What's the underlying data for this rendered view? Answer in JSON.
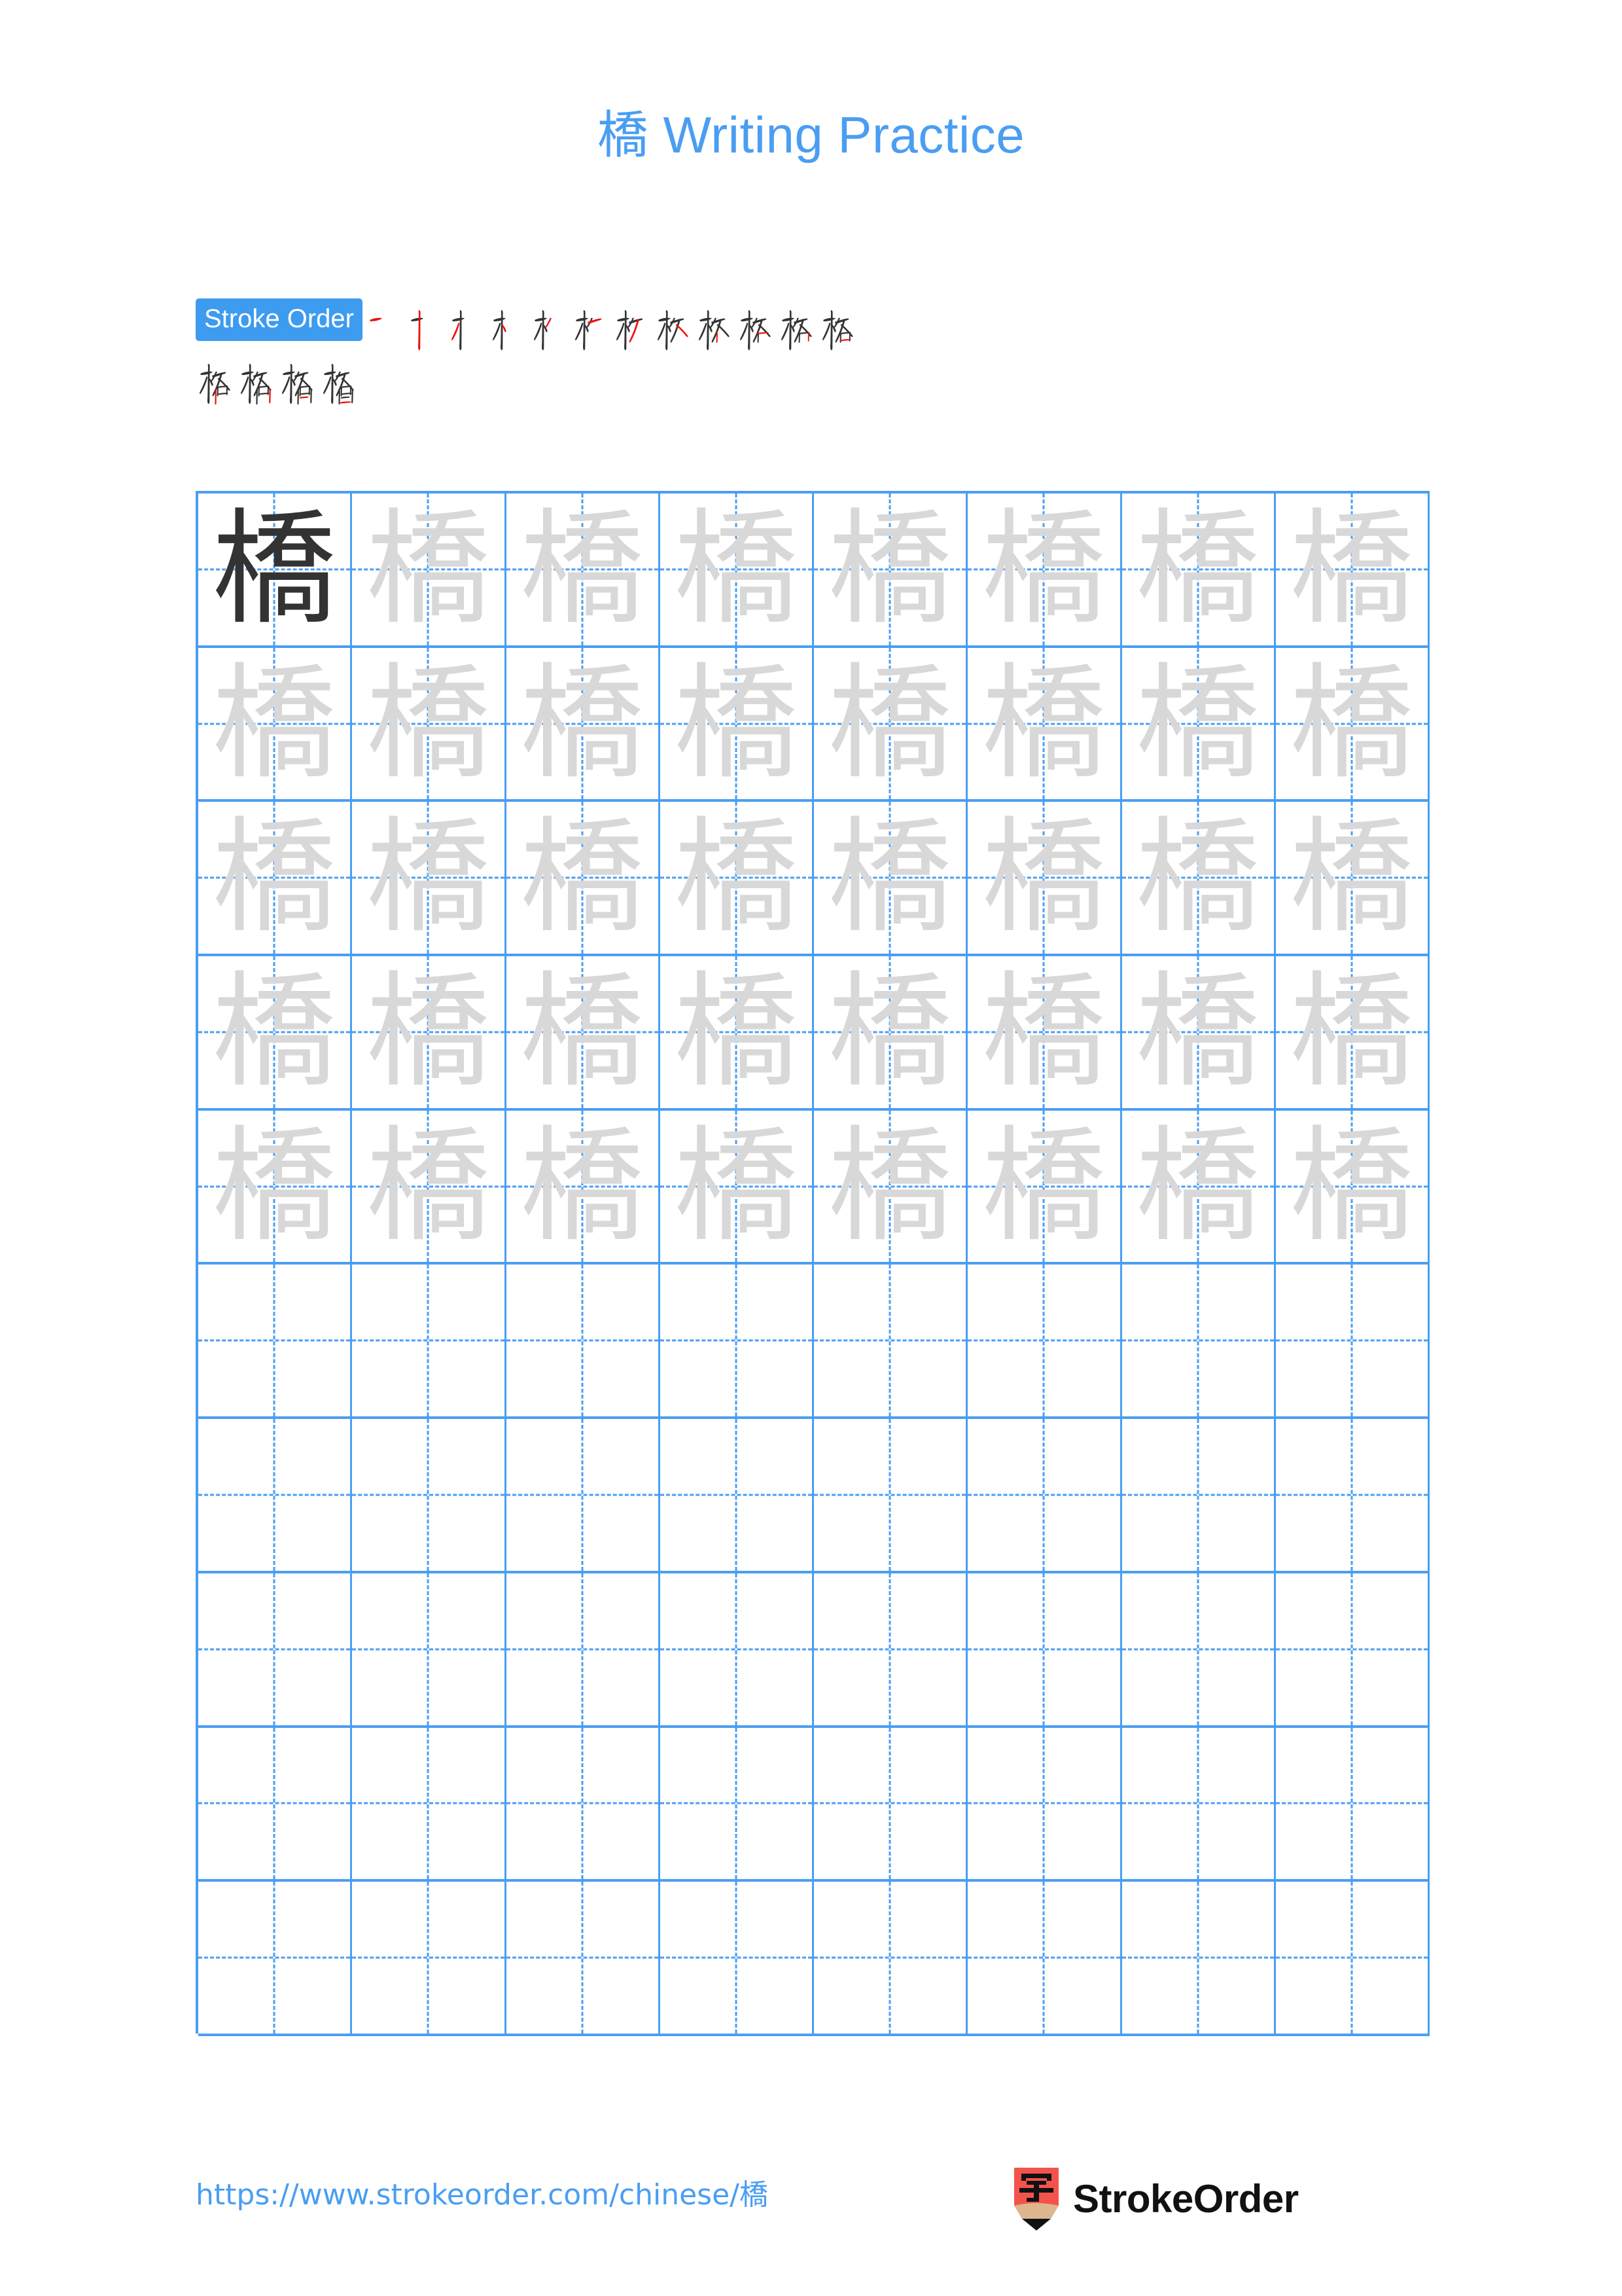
{
  "page": {
    "character": "橋",
    "title_suffix": " Writing Practice",
    "title_color": "#4a9ef2",
    "background_color": "#ffffff"
  },
  "stroke_order": {
    "badge_label": "Stroke Order",
    "badge_bg": "#3d9bf0",
    "badge_text_color": "#ffffff",
    "total_strokes": 16,
    "completed_stroke_color": "#333333",
    "current_stroke_color": "#ee1111",
    "row1_count": 12,
    "row2_count": 4,
    "steps": [
      {
        "index": 1,
        "strokes_shown": 1
      },
      {
        "index": 2,
        "strokes_shown": 2
      },
      {
        "index": 3,
        "strokes_shown": 3
      },
      {
        "index": 4,
        "strokes_shown": 4
      },
      {
        "index": 5,
        "strokes_shown": 5
      },
      {
        "index": 6,
        "strokes_shown": 6
      },
      {
        "index": 7,
        "strokes_shown": 7
      },
      {
        "index": 8,
        "strokes_shown": 8
      },
      {
        "index": 9,
        "strokes_shown": 9
      },
      {
        "index": 10,
        "strokes_shown": 10
      },
      {
        "index": 11,
        "strokes_shown": 11
      },
      {
        "index": 12,
        "strokes_shown": 12
      },
      {
        "index": 13,
        "strokes_shown": 13
      },
      {
        "index": 14,
        "strokes_shown": 14
      },
      {
        "index": 15,
        "strokes_shown": 15
      },
      {
        "index": 16,
        "strokes_shown": 16
      }
    ]
  },
  "grid": {
    "columns": 8,
    "rows": 10,
    "line_color": "#4a9ef2",
    "guide_style": "dashed",
    "dark_char_color": "#333333",
    "trace_char_color": "#d8d8d8",
    "rows_data": [
      {
        "row": 1,
        "cells": [
          "dark",
          "trace",
          "trace",
          "trace",
          "trace",
          "trace",
          "trace",
          "trace"
        ]
      },
      {
        "row": 2,
        "cells": [
          "trace",
          "trace",
          "trace",
          "trace",
          "trace",
          "trace",
          "trace",
          "trace"
        ]
      },
      {
        "row": 3,
        "cells": [
          "trace",
          "trace",
          "trace",
          "trace",
          "trace",
          "trace",
          "trace",
          "trace"
        ]
      },
      {
        "row": 4,
        "cells": [
          "trace",
          "trace",
          "trace",
          "trace",
          "trace",
          "trace",
          "trace",
          "trace"
        ]
      },
      {
        "row": 5,
        "cells": [
          "trace",
          "trace",
          "trace",
          "trace",
          "trace",
          "trace",
          "trace",
          "trace"
        ]
      },
      {
        "row": 6,
        "cells": [
          "empty",
          "empty",
          "empty",
          "empty",
          "empty",
          "empty",
          "empty",
          "empty"
        ]
      },
      {
        "row": 7,
        "cells": [
          "empty",
          "empty",
          "empty",
          "empty",
          "empty",
          "empty",
          "empty",
          "empty"
        ]
      },
      {
        "row": 8,
        "cells": [
          "empty",
          "empty",
          "empty",
          "empty",
          "empty",
          "empty",
          "empty",
          "empty"
        ]
      },
      {
        "row": 9,
        "cells": [
          "empty",
          "empty",
          "empty",
          "empty",
          "empty",
          "empty",
          "empty",
          "empty"
        ]
      },
      {
        "row": 10,
        "cells": [
          "empty",
          "empty",
          "empty",
          "empty",
          "empty",
          "empty",
          "empty",
          "empty"
        ]
      }
    ]
  },
  "footer": {
    "url": "https://www.strokeorder.com/chinese/橋",
    "url_color": "#4a9ef2",
    "brand_name": "StrokeOrder",
    "logo_character": "字",
    "logo_body_color": "#f4534d",
    "logo_wood_color": "#dcb68e",
    "logo_tip_color": "#111111"
  }
}
